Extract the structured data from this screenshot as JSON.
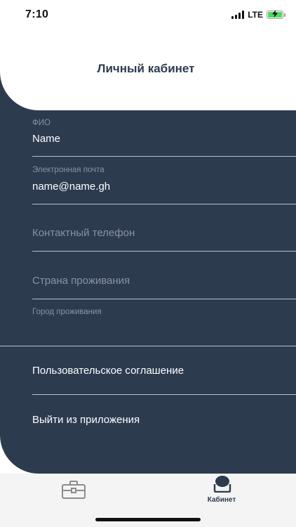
{
  "status_bar": {
    "time": "7:10",
    "network": "LTE"
  },
  "header": {
    "title": "Личный кабинет"
  },
  "fields": [
    {
      "label": "ФИО",
      "value": "Name",
      "placeholder": ""
    },
    {
      "label": "Электронная почта",
      "value": "name@name.gh",
      "placeholder": ""
    },
    {
      "label": "",
      "value": "",
      "placeholder": "Контактный телефон"
    },
    {
      "label": "",
      "value": "",
      "placeholder": "Страна проживания"
    },
    {
      "label": "Город проживания",
      "value": "",
      "placeholder": ""
    }
  ],
  "menu": {
    "agreement": "Пользовательское соглашение",
    "logout": "Выйти из приложения"
  },
  "tab_bar": {
    "items": [
      {
        "label": "",
        "icon": "briefcase-icon",
        "active": false
      },
      {
        "label": "Кабинет",
        "icon": "cabinet-icon",
        "active": true
      }
    ]
  },
  "colors": {
    "panel": "#2d3b4f",
    "label": "#8993a1",
    "divider": "#b9c0c9",
    "tab_bar": "#f4f4f4"
  }
}
